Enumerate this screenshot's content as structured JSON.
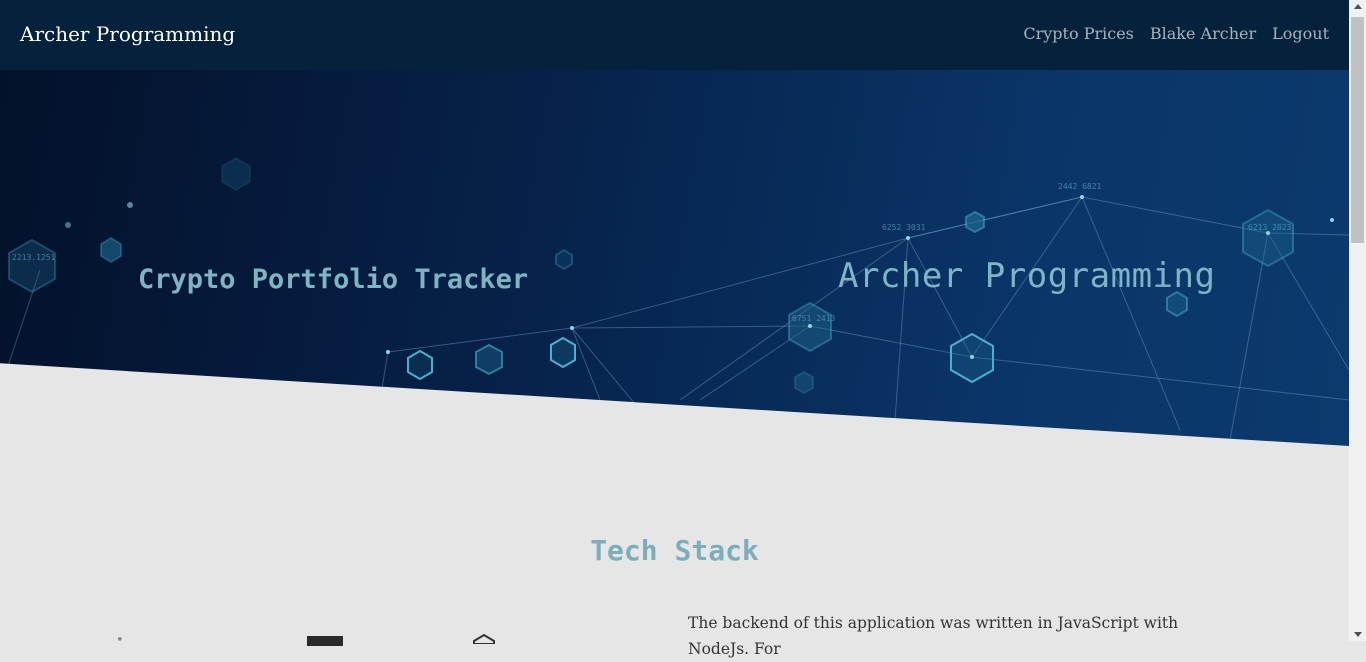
{
  "navbar": {
    "brand": "Archer Programming",
    "links": [
      {
        "label": "Crypto Prices"
      },
      {
        "label": "Blake Archer"
      },
      {
        "label": "Logout"
      }
    ]
  },
  "hero": {
    "left_title": "Crypto Portfolio Tracker",
    "right_title": "Archer Programming",
    "background_digits": [
      "2213.1251",
      "2442 6821",
      "6252 3031",
      "6751 2413",
      "6213 2023"
    ]
  },
  "tech_stack": {
    "title": "Tech Stack",
    "description": "The backend of this application was written in JavaScript with NodeJs. For"
  },
  "colors": {
    "navbar_bg": "#04223b",
    "hero_text": "#7fb5c3",
    "section_title": "#7aaebb",
    "page_bg": "#e6e6e6"
  }
}
